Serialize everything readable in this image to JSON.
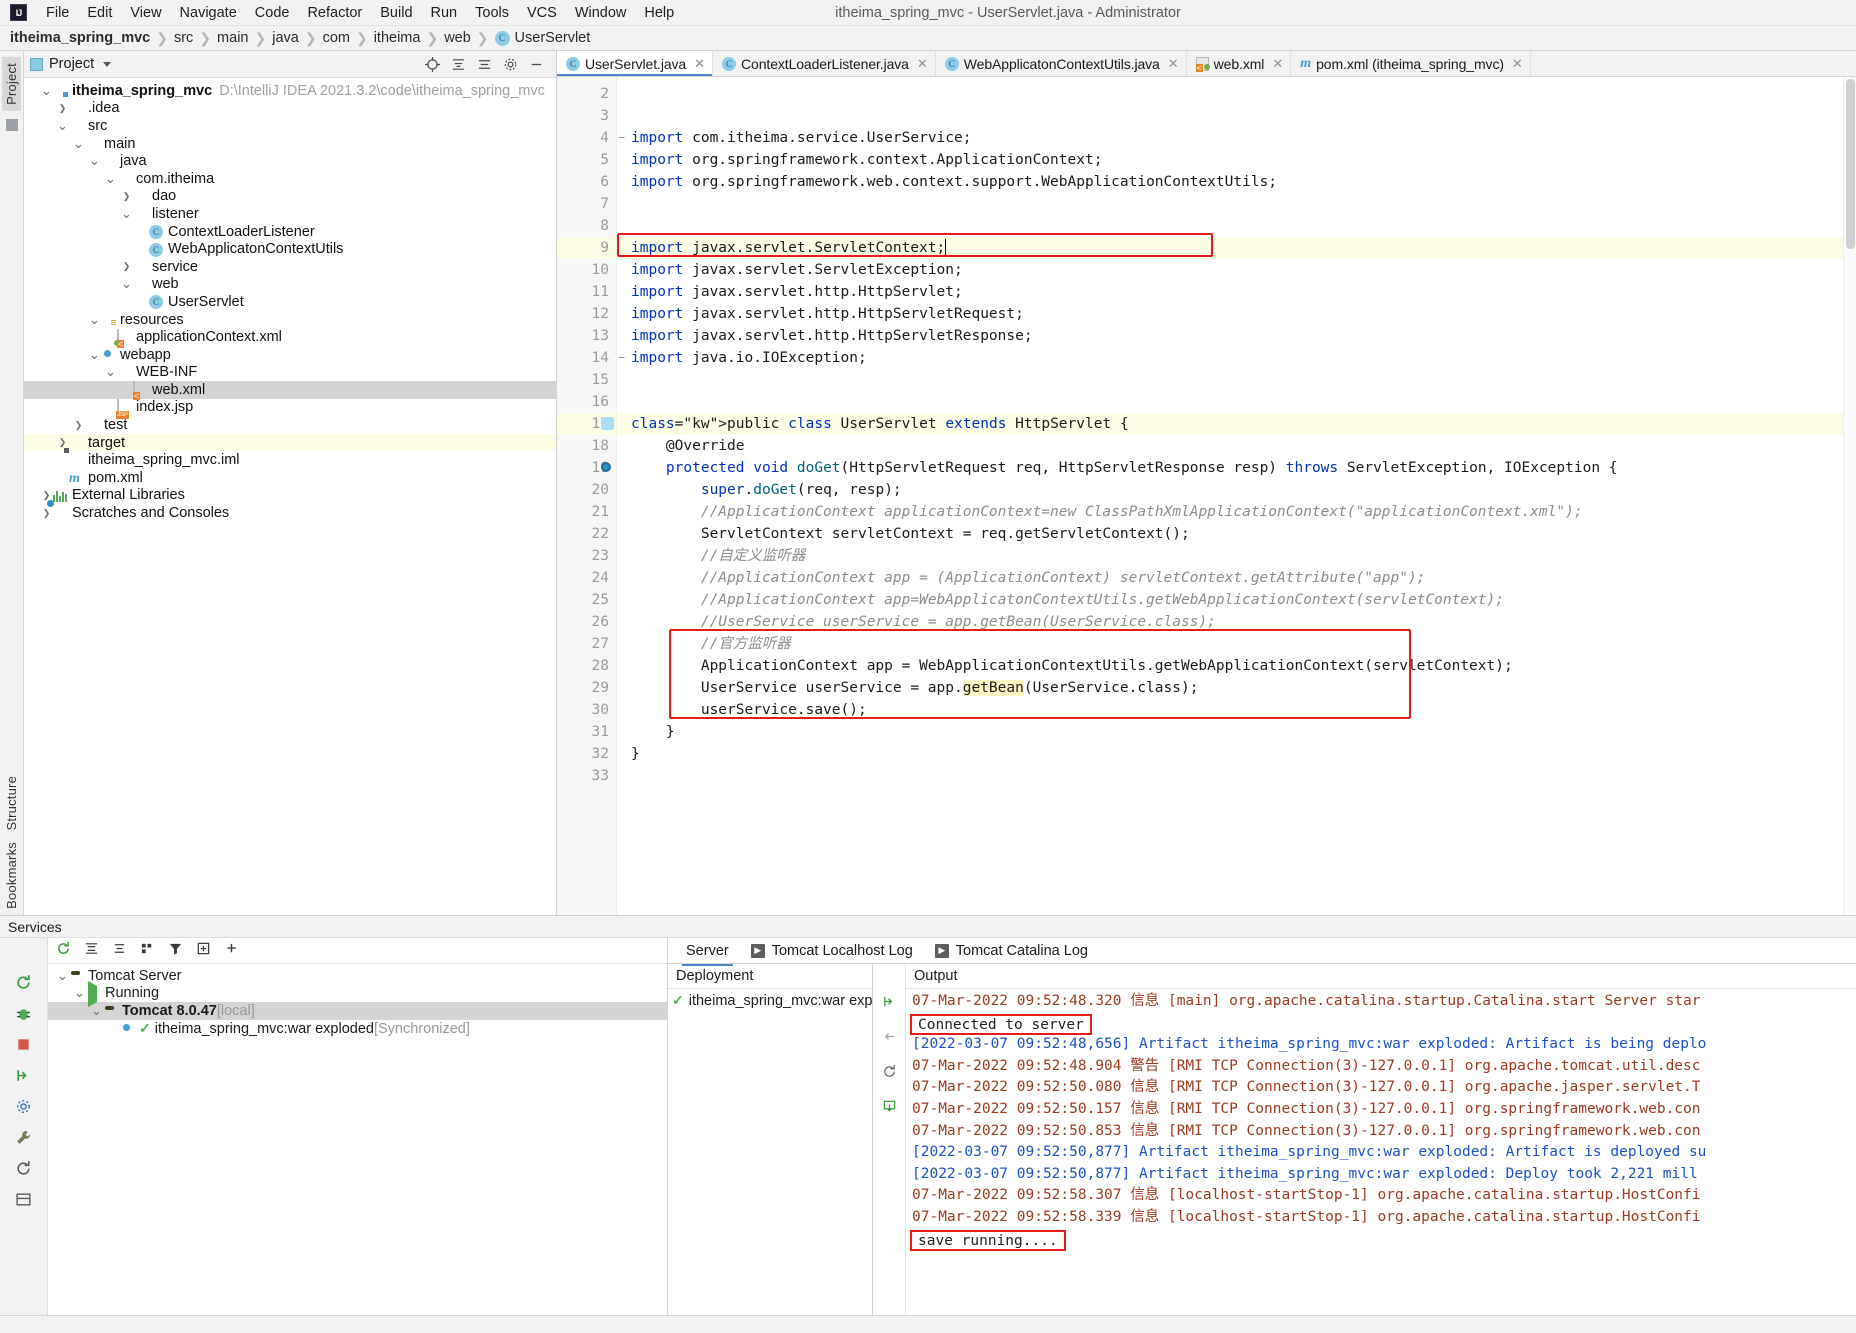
{
  "window": {
    "title": "itheima_spring_mvc - UserServlet.java - Administrator"
  },
  "menubar": {
    "items": [
      "File",
      "Edit",
      "View",
      "Navigate",
      "Code",
      "Refactor",
      "Build",
      "Run",
      "Tools",
      "VCS",
      "Window",
      "Help"
    ]
  },
  "breadcrumb": {
    "items": [
      "itheima_spring_mvc",
      "src",
      "main",
      "java",
      "com",
      "itheima",
      "web",
      "UserServlet"
    ]
  },
  "left_strip": {
    "project_label": "Project",
    "structure_label": "Structure",
    "bookmarks_label": "Bookmarks"
  },
  "project": {
    "title": "Project",
    "tree": [
      {
        "indent": 0,
        "arrow": "v",
        "icon": "folder-module",
        "label": "itheima_spring_mvc",
        "bold": true,
        "path": "D:\\IntelliJ IDEA 2021.3.2\\code\\itheima_spring_mvc"
      },
      {
        "indent": 1,
        "arrow": ">",
        "icon": "folder",
        "label": ".idea"
      },
      {
        "indent": 1,
        "arrow": "v",
        "icon": "folder",
        "label": "src"
      },
      {
        "indent": 2,
        "arrow": "v",
        "icon": "folder",
        "label": "main"
      },
      {
        "indent": 3,
        "arrow": "v",
        "icon": "folder-blue",
        "label": "java"
      },
      {
        "indent": 4,
        "arrow": "v",
        "icon": "package",
        "label": "com.itheima"
      },
      {
        "indent": 5,
        "arrow": ">",
        "icon": "package",
        "label": "dao"
      },
      {
        "indent": 5,
        "arrow": "v",
        "icon": "package",
        "label": "listener"
      },
      {
        "indent": 6,
        "arrow": "",
        "icon": "class",
        "label": "ContextLoaderListener"
      },
      {
        "indent": 6,
        "arrow": "",
        "icon": "class",
        "label": "WebApplicatonContextUtils"
      },
      {
        "indent": 5,
        "arrow": ">",
        "icon": "package",
        "label": "service"
      },
      {
        "indent": 5,
        "arrow": "v",
        "icon": "package",
        "label": "web"
      },
      {
        "indent": 6,
        "arrow": "",
        "icon": "class",
        "label": "UserServlet"
      },
      {
        "indent": 3,
        "arrow": "v",
        "icon": "folder-resources",
        "label": "resources"
      },
      {
        "indent": 4,
        "arrow": "",
        "icon": "xml-spring",
        "label": "applicationContext.xml"
      },
      {
        "indent": 3,
        "arrow": "v",
        "icon": "webapp",
        "label": "webapp"
      },
      {
        "indent": 4,
        "arrow": "v",
        "icon": "folder",
        "label": "WEB-INF"
      },
      {
        "indent": 5,
        "arrow": "",
        "icon": "xml",
        "label": "web.xml",
        "selected": true
      },
      {
        "indent": 4,
        "arrow": "",
        "icon": "jsp",
        "label": "index.jsp"
      },
      {
        "indent": 2,
        "arrow": ">",
        "icon": "folder",
        "label": "test"
      },
      {
        "indent": 1,
        "arrow": ">",
        "icon": "folder-target",
        "label": "target",
        "highlighted": true
      },
      {
        "indent": 1,
        "arrow": "",
        "icon": "iml",
        "label": "itheima_spring_mvc.iml"
      },
      {
        "indent": 1,
        "arrow": "",
        "icon": "maven",
        "label": "pom.xml"
      },
      {
        "indent": 0,
        "arrow": ">",
        "icon": "libraries",
        "label": "External Libraries"
      },
      {
        "indent": 0,
        "arrow": ">",
        "icon": "scratches",
        "label": "Scratches and Consoles"
      }
    ]
  },
  "editor": {
    "tabs": [
      {
        "label": "UserServlet.java",
        "icon": "class-icon",
        "active": true
      },
      {
        "label": "ContextLoaderListener.java",
        "icon": "class-icon",
        "active": false
      },
      {
        "label": "WebApplicatonContextUtils.java",
        "icon": "class-icon",
        "active": false
      },
      {
        "label": "web.xml",
        "icon": "xml-icon",
        "active": false
      },
      {
        "label": "pom.xml (itheima_spring_mvc)",
        "icon": "maven-icon",
        "active": false
      }
    ],
    "first_line_number": 2,
    "lines": [
      {
        "n": 2,
        "text": ""
      },
      {
        "n": 3,
        "text": ""
      },
      {
        "n": 4,
        "text": "import com.itheima.service.UserService;",
        "fold": true
      },
      {
        "n": 5,
        "text": "import org.springframework.context.ApplicationContext;"
      },
      {
        "n": 6,
        "text": "import org.springframework.web.context.support.WebApplicationContextUtils;",
        "boxed": true
      },
      {
        "n": 7,
        "text": ""
      },
      {
        "n": 8,
        "text": ""
      },
      {
        "n": 9,
        "text": "import javax.servlet.ServletContext;",
        "current": true,
        "caret": true
      },
      {
        "n": 10,
        "text": "import javax.servlet.ServletException;"
      },
      {
        "n": 11,
        "text": "import javax.servlet.http.HttpServlet;"
      },
      {
        "n": 12,
        "text": "import javax.servlet.http.HttpServletRequest;"
      },
      {
        "n": 13,
        "text": "import javax.servlet.http.HttpServletResponse;"
      },
      {
        "n": 14,
        "text": "import java.io.IOException;",
        "fold": true
      },
      {
        "n": 15,
        "text": ""
      },
      {
        "n": 16,
        "text": ""
      },
      {
        "n": 17,
        "text": "public class UserServlet extends HttpServlet {",
        "gutter_mark": "class"
      },
      {
        "n": 18,
        "text": "    @Override"
      },
      {
        "n": 19,
        "text": "    protected void doGet(HttpServletRequest req, HttpServletResponse resp) throws ServletException, IOException {",
        "gutter_mark": "override-breakpoint"
      },
      {
        "n": 20,
        "text": "        super.doGet(req, resp);"
      },
      {
        "n": 21,
        "text": "        //ApplicationContext applicationContext=new ClassPathXmlApplicationContext(\"applicationContext.xml\");"
      },
      {
        "n": 22,
        "text": "        ServletContext servletContext = req.getServletContext();"
      },
      {
        "n": 23,
        "text": "        //自定义监听器"
      },
      {
        "n": 24,
        "text": "        //ApplicationContext app = (ApplicationContext) servletContext.getAttribute(\"app\");"
      },
      {
        "n": 25,
        "text": "        //ApplicationContext app=WebApplicatonContextUtils.getWebApplicationContext(servletContext);"
      },
      {
        "n": 26,
        "text": "        //UserService userService = app.getBean(UserService.class);"
      },
      {
        "n": 27,
        "text": "        //官方监听器"
      },
      {
        "n": 28,
        "text": "        ApplicationContext app = WebApplicationContextUtils.getWebApplicationContext(servletContext);"
      },
      {
        "n": 29,
        "text": "        UserService userService = app.getBean(UserService.class);"
      },
      {
        "n": 30,
        "text": "        userService.save();"
      },
      {
        "n": 31,
        "text": "    }"
      },
      {
        "n": 32,
        "text": "}"
      },
      {
        "n": 33,
        "text": ""
      }
    ]
  },
  "services": {
    "title": "Services",
    "tree": [
      {
        "indent": 0,
        "arrow": "v",
        "icon": "tomcat-icon",
        "label": "Tomcat Server"
      },
      {
        "indent": 1,
        "arrow": "v",
        "icon": "play-icon",
        "label": "Running"
      },
      {
        "indent": 2,
        "arrow": "v",
        "icon": "tomcat-icon",
        "label": "Tomcat 8.0.47",
        "suffix": "[local]",
        "bold": true,
        "selected": true
      },
      {
        "indent": 3,
        "arrow": "",
        "icon": "artifact-icon",
        "label": "itheima_spring_mvc:war exploded",
        "suffix": "[Synchronized]"
      }
    ],
    "tabs": [
      {
        "label": "Server",
        "active": true,
        "icon": ""
      },
      {
        "label": "Tomcat Localhost Log",
        "active": false,
        "icon": "log-badge"
      },
      {
        "label": "Tomcat Catalina Log",
        "active": false,
        "icon": "log-badge"
      }
    ],
    "deployment": {
      "header": "Deployment",
      "rows": [
        {
          "label": "itheima_spring_mvc:war exploded",
          "status": "ok"
        }
      ]
    },
    "output": {
      "header": "Output",
      "lines": [
        {
          "type": "red",
          "text": "07-Mar-2022 09:52:48.320 信息 [main] org.apache.catalina.startup.Catalina.start Server star"
        },
        {
          "type": "dark",
          "text": "Connected to server",
          "boxed": true
        },
        {
          "type": "blue",
          "text": "[2022-03-07 09:52:48,656] Artifact itheima_spring_mvc:war exploded: Artifact is being deplo"
        },
        {
          "type": "red",
          "text": "07-Mar-2022 09:52:48.904 警告 [RMI TCP Connection(3)-127.0.0.1] org.apache.tomcat.util.desc"
        },
        {
          "type": "red",
          "text": "07-Mar-2022 09:52:50.080 信息 [RMI TCP Connection(3)-127.0.0.1] org.apache.jasper.servlet.T"
        },
        {
          "type": "red",
          "text": "07-Mar-2022 09:52:50.157 信息 [RMI TCP Connection(3)-127.0.0.1] org.springframework.web.con"
        },
        {
          "type": "red",
          "text": "07-Mar-2022 09:52:50.853 信息 [RMI TCP Connection(3)-127.0.0.1] org.springframework.web.con"
        },
        {
          "type": "blue",
          "text": "[2022-03-07 09:52:50,877] Artifact itheima_spring_mvc:war exploded: Artifact is deployed su"
        },
        {
          "type": "blue",
          "text": "[2022-03-07 09:52:50,877] Artifact itheima_spring_mvc:war exploded: Deploy took 2,221 mill"
        },
        {
          "type": "red",
          "text": "07-Mar-2022 09:52:58.307 信息 [localhost-startStop-1] org.apache.catalina.startup.HostConfi"
        },
        {
          "type": "red",
          "text": "07-Mar-2022 09:52:58.339 信息 [localhost-startStop-1] org.apache.catalina.startup.HostConfi"
        },
        {
          "type": "dark",
          "text": "save running....",
          "boxed": true
        }
      ]
    }
  },
  "colors": {
    "accent_blue": "#4a88c7",
    "highlight_red": "#e81b1b",
    "keyword_blue": "#0033b3",
    "comment_gray": "#8c8c8c",
    "log_red": "#9c3a1f",
    "log_blue": "#1a52c4",
    "selection_gray": "#d4d4d4"
  }
}
